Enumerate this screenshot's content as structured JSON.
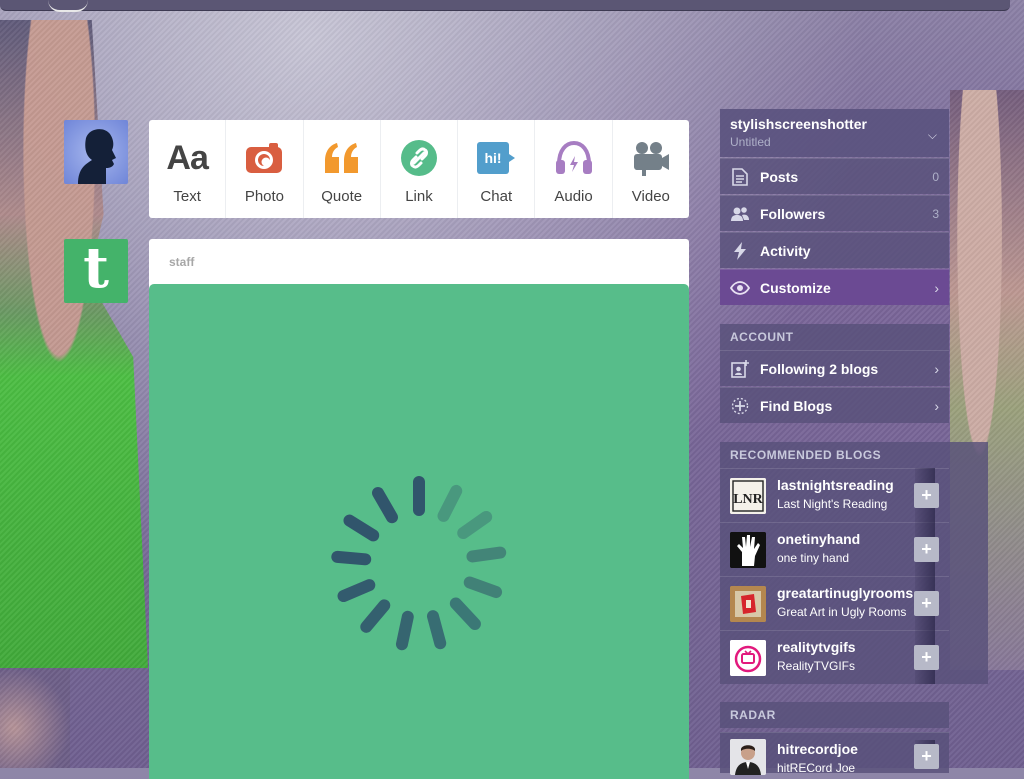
{
  "post_types": [
    {
      "label": "Text",
      "icon": "text-icon",
      "color": "#444444"
    },
    {
      "label": "Photo",
      "icon": "camera-icon",
      "color": "#d95e40"
    },
    {
      "label": "Quote",
      "icon": "quote-icon",
      "color": "#f2992e"
    },
    {
      "label": "Link",
      "icon": "link-icon",
      "color": "#56bc8a"
    },
    {
      "label": "Chat",
      "icon": "chat-icon",
      "color": "#529ecc"
    },
    {
      "label": "Audio",
      "icon": "headphones-icon",
      "color": "#a77dc2"
    },
    {
      "label": "Video",
      "icon": "video-camera-icon",
      "color": "#748089"
    }
  ],
  "text_glyph": "Aa",
  "chat_glyph": "hi!",
  "post": {
    "author": "staff",
    "media_color": "#57bd8a",
    "loading": true
  },
  "tumblr_glyph": "t",
  "account": {
    "name": "stylishscreenshotter",
    "subtitle": "Untitled",
    "items": [
      {
        "label": "Posts",
        "count": "0",
        "icon": "posts-icon"
      },
      {
        "label": "Followers",
        "count": "3",
        "icon": "followers-icon"
      },
      {
        "label": "Activity",
        "icon": "activity-icon"
      },
      {
        "label": "Customize",
        "icon": "eye-icon",
        "active": true
      }
    ]
  },
  "account_section": {
    "label": "ACCOUNT",
    "items": [
      {
        "label": "Following 2 blogs",
        "icon": "following-icon"
      },
      {
        "label": "Find Blogs",
        "icon": "find-blogs-icon"
      }
    ]
  },
  "recommended": {
    "label": "RECOMMENDED BLOGS",
    "blogs": [
      {
        "name": "lastnightsreading",
        "title": "Last Night's Reading",
        "avatar_text": "LNR"
      },
      {
        "name": "onetinyhand",
        "title": "one tiny hand"
      },
      {
        "name": "greatartinuglyrooms",
        "title": "Great Art in Ugly Rooms"
      },
      {
        "name": "realitytvgifs",
        "title": "RealityTVGIFs"
      }
    ],
    "follow_label": "+"
  },
  "radar": {
    "label": "RADAR",
    "item": {
      "name": "hitrecordjoe",
      "title": "hitRECord Joe"
    },
    "follow_label": "+"
  },
  "colors": {
    "accent": "#6b4a93",
    "panel": "#58507a",
    "tumblr_green": "#44b36a"
  }
}
